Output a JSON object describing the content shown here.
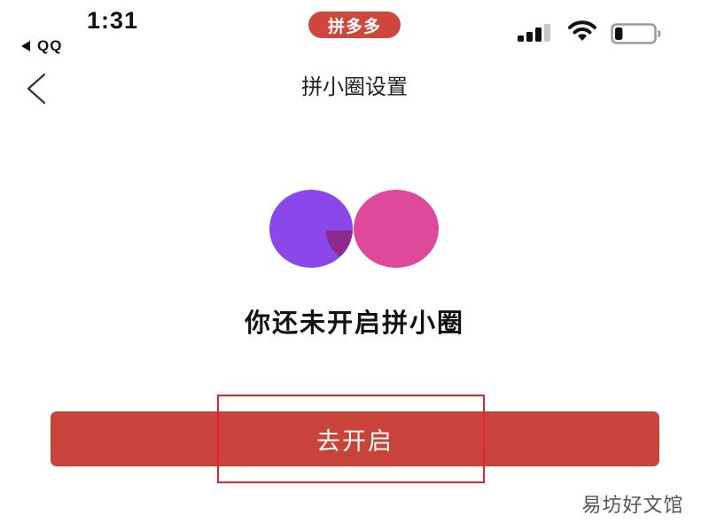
{
  "colors": {
    "accent": "#d0463a",
    "button": "#c9433a",
    "highlight": "#e82126",
    "circle_left": "#8a47e9",
    "circle_right": "#e0489a",
    "circle_overlap": "#8e2a8c",
    "text": "#111111"
  },
  "status_bar": {
    "time": "1:31",
    "back_app": "QQ",
    "app_pill": "拼多多",
    "battery_level": 0.2
  },
  "nav": {
    "back_icon": "chevron-left-icon",
    "title": "拼小圈设置"
  },
  "main": {
    "logo_icon": "overlapping-circles-icon",
    "message": "你还未开启拼小圈",
    "button_label": "去开启"
  },
  "watermark": "易坊好文馆"
}
